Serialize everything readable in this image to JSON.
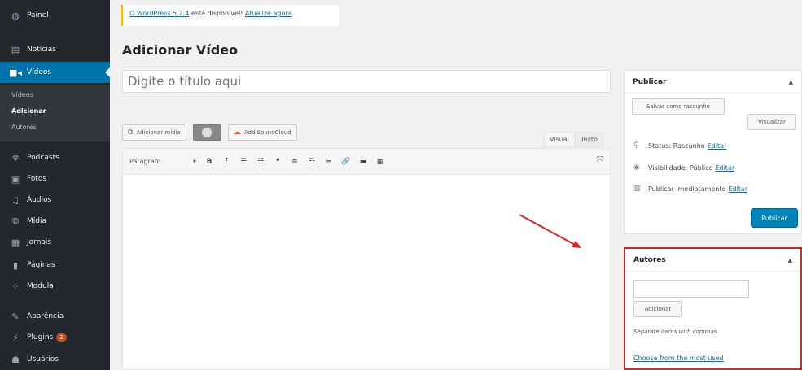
{
  "sidebar": {
    "items": [
      {
        "label": "Painel",
        "icon": "dashboard-icon"
      },
      {
        "label": "Notícias",
        "icon": "news-icon"
      },
      {
        "label": "Vídeos",
        "icon": "video-icon"
      },
      {
        "label": "Podcasts",
        "icon": "microphone-icon"
      },
      {
        "label": "Fotos",
        "icon": "photo-icon"
      },
      {
        "label": "Áudios",
        "icon": "music-icon"
      },
      {
        "label": "Mídia",
        "icon": "media-icon"
      },
      {
        "label": "Jornais",
        "icon": "grid-icon"
      },
      {
        "label": "Páginas",
        "icon": "page-icon"
      },
      {
        "label": "Modula",
        "icon": "modula-icon"
      },
      {
        "label": "Aparência",
        "icon": "brush-icon"
      },
      {
        "label": "Plugins",
        "icon": "plugin-icon",
        "badge": "2"
      },
      {
        "label": "Usuários",
        "icon": "user-icon"
      }
    ],
    "submenu": [
      "Vídeos",
      "Adicionar",
      "Autores"
    ]
  },
  "notice": {
    "link1": "O WordPress 5.2.4",
    "text": " está disponível! ",
    "link2": "Atualize agora",
    "end": "."
  },
  "page": {
    "title": "Adicionar Vídeo",
    "title_placeholder": "Digite o título aqui"
  },
  "editor": {
    "add_media": "Adicionar mídia",
    "add_soundcloud": "Add SoundCloud",
    "tab_visual": "Visual",
    "tab_text": "Texto",
    "format": "Parágrafo"
  },
  "publish": {
    "title": "Publicar",
    "save_draft": "Salvar como rascunho",
    "preview": "Visualizar",
    "status_label": "Status: Rascunho",
    "visibility_label": "Visibilidade: Público",
    "schedule_label": "Publicar imediatamente",
    "edit": "Editar",
    "publish_button": "Publicar"
  },
  "authors": {
    "title": "Autores",
    "add_button": "Adicionar",
    "hint": "Separate items with commas",
    "most_used_link": "Choose from the most used"
  },
  "colors": {
    "sidebar_bg": "#23282d",
    "active_item": "#0073aa",
    "publish_button": "#0085ba",
    "highlight_border": "#dd2222",
    "arrow": "#dd2222"
  }
}
